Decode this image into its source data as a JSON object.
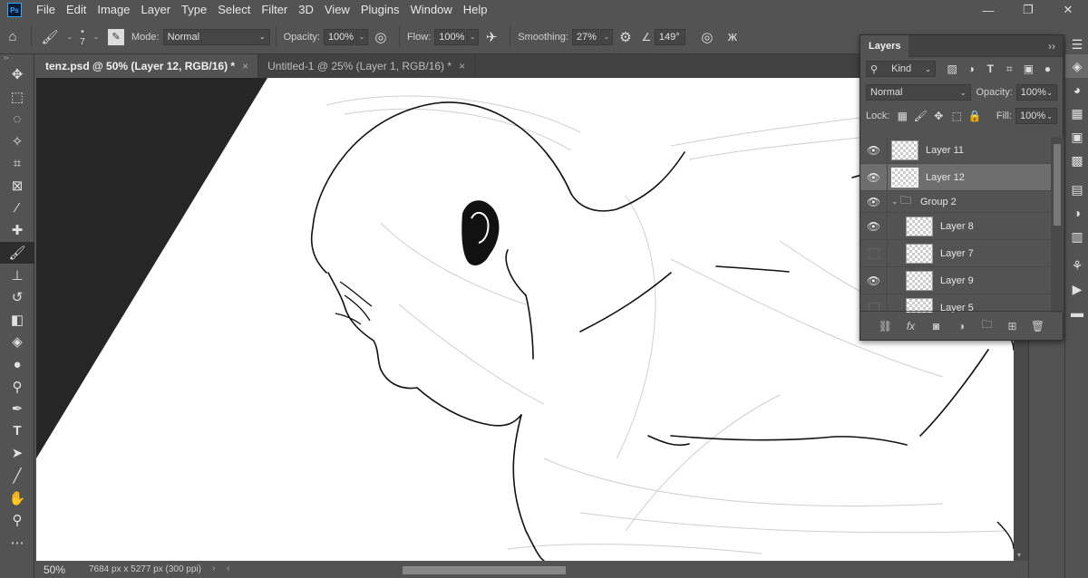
{
  "menu": {
    "logo_text": "Ps",
    "items": [
      "File",
      "Edit",
      "Image",
      "Layer",
      "Type",
      "Select",
      "Filter",
      "3D",
      "View",
      "Plugins",
      "Window",
      "Help"
    ],
    "window_controls": [
      "—",
      "❐",
      "✕"
    ]
  },
  "options": {
    "brush_size": "7",
    "mode_label": "Mode:",
    "mode_value": "Normal",
    "opacity_label": "Opacity:",
    "opacity_value": "100%",
    "flow_label": "Flow:",
    "flow_value": "100%",
    "smoothing_label": "Smoothing:",
    "smoothing_value": "27%",
    "angle_value": "149°"
  },
  "tabs": [
    {
      "label": "tenz.psd @ 50% (Layer 12, RGB/16) *",
      "close": "×"
    },
    {
      "label": "Untitled-1 @ 25% (Layer 1, RGB/16) *",
      "close": "×"
    }
  ],
  "status": {
    "zoom": "50%",
    "doc_info": "7684 px x 5277 px (300 ppi)"
  },
  "layers_panel": {
    "title": "Layers",
    "filter_label": "Kind",
    "blend_mode": "Normal",
    "opacity_label": "Opacity:",
    "opacity_value": "100%",
    "lock_label": "Lock:",
    "fill_label": "Fill:",
    "fill_value": "100%",
    "layers": [
      {
        "name": "Layer 11",
        "visible": true
      },
      {
        "name": "Layer 12",
        "visible": true,
        "selected": true
      },
      {
        "name": "Group 2",
        "visible": true,
        "group": true
      },
      {
        "name": "Layer 8",
        "visible": true
      },
      {
        "name": "Layer 7",
        "visible": false
      },
      {
        "name": "Layer 9",
        "visible": true
      },
      {
        "name": "Layer 5",
        "visible": false
      }
    ]
  },
  "colors": {
    "ui_bg": "#535353",
    "canvas_bg": "#ffffff",
    "pasteboard": "#262626",
    "accent": "#31a8ff"
  }
}
